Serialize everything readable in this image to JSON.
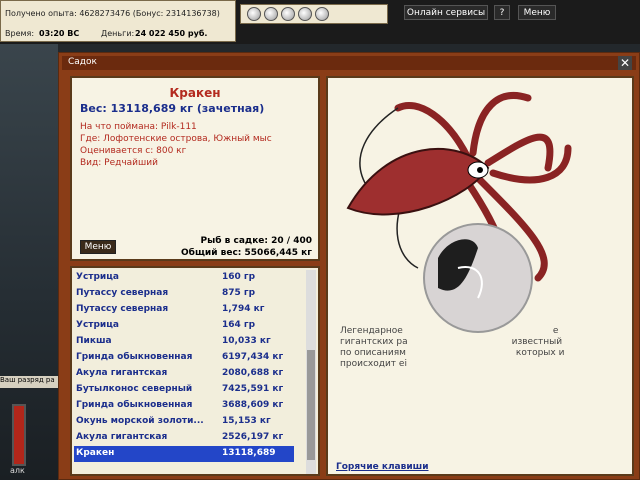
{
  "stats": {
    "experience": "Получено опыта: 4628273476 (Бонус: 2314136738)",
    "time_label": "Время:",
    "time_value": "03:20 ВС",
    "money_label": "Деньги:",
    "money_value": "24 022 450 руб."
  },
  "top_buttons": {
    "online": "Онлайн сервисы",
    "help": "?",
    "menu": "Меню"
  },
  "side": {
    "rank": "Ваш разряд ра",
    "gauge_label": "алк"
  },
  "window": {
    "title": "Садок",
    "close": "✕"
  },
  "fish": {
    "name": "Кракен",
    "weight": "Вес: 13118,689 кг (зачетная)",
    "bait": "На что поймана: Pilk-111",
    "location": "Где: Лофотенские острова, Южный мыс",
    "value": "Оценивается с: 800 кг",
    "kind": "Вид: Редчайший",
    "menu": "Меню",
    "count": "Рыб в садке: 20 / 400",
    "total": "Общий вес: 55066,445 кг"
  },
  "list": [
    {
      "name": "Устрица",
      "weight": "160 гр"
    },
    {
      "name": "Путассу северная",
      "weight": "875 гр"
    },
    {
      "name": "Путассу северная",
      "weight": "1,794 кг"
    },
    {
      "name": "Устрица",
      "weight": "164 гр"
    },
    {
      "name": "Пикша",
      "weight": "10,033 кг"
    },
    {
      "name": "Гринда обыкновенная",
      "weight": "6197,434 кг"
    },
    {
      "name": "Акула гигантская",
      "weight": "2080,688 кг"
    },
    {
      "name": "Бутылконос северный",
      "weight": "7425,591 кг"
    },
    {
      "name": "Гринда обыкновенная",
      "weight": "3688,609 кг"
    },
    {
      "name": "Окунь морской золоти...",
      "weight": "15,153 кг"
    },
    {
      "name": "Акула гигантская",
      "weight": "2526,197 кг"
    },
    {
      "name": "Кракен",
      "weight": "13118,689"
    }
  ],
  "description": {
    "line1a": "Легендарное",
    "line1b": "е",
    "line2a": "гигантских ра",
    "line2b": "известный",
    "line3a": "по описаниям",
    "line3b": "которых и",
    "line4": "происходит ei"
  },
  "hotkeys": "Горячие клавиши",
  "colors": {
    "accent": "#2346c8",
    "title": "#b32a1f",
    "frame": "#8a3d17"
  }
}
